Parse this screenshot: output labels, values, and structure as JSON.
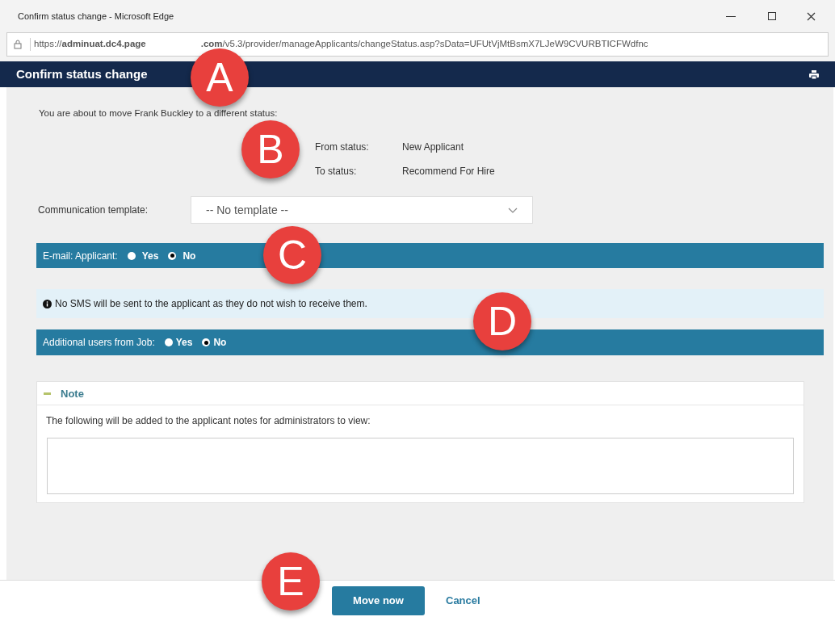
{
  "window": {
    "title": "Confirm status change - Microsoft Edge"
  },
  "address_bar": {
    "url_start": "https://**adminuat.dc4.page**",
    "url_end": "**.com**/v5.3/provider/manageApplicants/changeStatus.asp?sData=UFUtVjMtBsmX7LJeW9CVURBTICFWdfnc"
  },
  "dialog": {
    "title": "Confirm status change"
  },
  "intro": "You are about to move Frank Buckley to a different status:",
  "statuses": [
    {
      "label": "From status:",
      "value": "New Applicant"
    },
    {
      "label": "To status:",
      "value": "Recommend For Hire"
    }
  ],
  "template": {
    "label": "Communication template:",
    "value": "-- No template --"
  },
  "email_applicant": {
    "label": "E-mail: Applicant:",
    "options": [
      {
        "label": "Yes",
        "selected": false
      },
      {
        "label": "No",
        "selected": true
      }
    ]
  },
  "sms_notice": "No SMS will be sent to the applicant as they do not wish to receive them.",
  "additional_users": {
    "label": "Additional users from Job:",
    "options": [
      {
        "label": "Yes",
        "selected": false
      },
      {
        "label": "No",
        "selected": true
      }
    ]
  },
  "note": {
    "title": "Note",
    "description": "The following will be added to the applicant notes for administrators to view:"
  },
  "buttons": [
    {
      "label": "Move now",
      "kind": "primary"
    },
    {
      "label": "Cancel",
      "kind": "link"
    }
  ],
  "callouts": [
    "A",
    "B",
    "C",
    "D",
    "E"
  ]
}
